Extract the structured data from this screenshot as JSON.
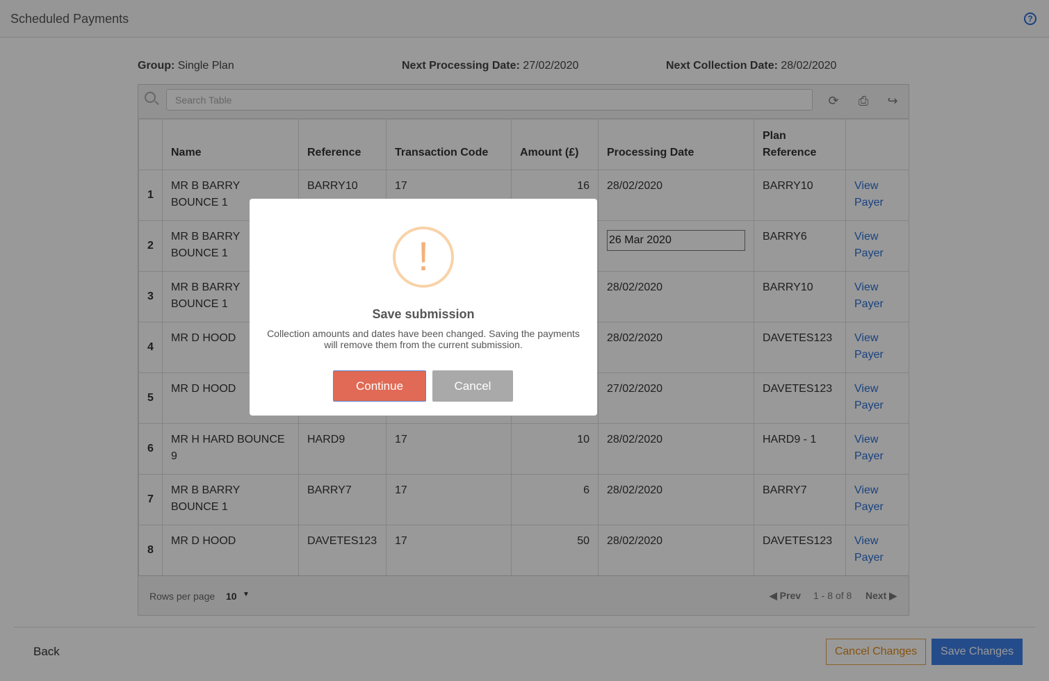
{
  "header": {
    "title": "Scheduled Payments",
    "help_icon": "?"
  },
  "info": {
    "group_label": "Group:",
    "group_value": "Single Plan",
    "processing_label": "Next Processing Date:",
    "processing_value": "27/02/2020",
    "collection_label": "Next Collection Date:",
    "collection_value": "28/02/2020"
  },
  "search": {
    "placeholder": "Search Table"
  },
  "toolbar": {
    "refresh_icon": "⟳",
    "print_icon": "⎙",
    "export_icon": "↪"
  },
  "table": {
    "headers": [
      "",
      "Name",
      "Reference",
      "Transaction Code",
      "Amount (£)",
      "Processing Date",
      "Plan Reference",
      ""
    ],
    "rows": [
      {
        "idx": "1",
        "name": "MR B BARRY BOUNCE 1",
        "reference": "BARRY10",
        "code": "17",
        "amount": "16",
        "date": "28/02/2020",
        "plan": "BARRY10",
        "link": "View Payer"
      },
      {
        "idx": "2",
        "name": "MR B BARRY BOUNCE 1",
        "reference": "",
        "code": "",
        "amount": "",
        "date": "26 Mar 2020",
        "plan": "BARRY6",
        "link": "View Payer"
      },
      {
        "idx": "3",
        "name": "MR B BARRY BOUNCE 1",
        "reference": "",
        "code": "",
        "amount": "",
        "date": "28/02/2020",
        "plan": "BARRY10",
        "link": "View Payer"
      },
      {
        "idx": "4",
        "name": "MR D HOOD",
        "reference": "",
        "code": "",
        "amount": "",
        "date": "28/02/2020",
        "plan": "DAVETES123",
        "link": "View Payer"
      },
      {
        "idx": "5",
        "name": "MR D HOOD",
        "reference": "",
        "code": "",
        "amount": "",
        "date": "27/02/2020",
        "plan": "DAVETES123",
        "link": "View Payer"
      },
      {
        "idx": "6",
        "name": "MR H HARD BOUNCE 9",
        "reference": "HARD9",
        "code": "17",
        "amount": "10",
        "date": "28/02/2020",
        "plan": "HARD9 - 1",
        "link": "View Payer"
      },
      {
        "idx": "7",
        "name": "MR B BARRY BOUNCE 1",
        "reference": "BARRY7",
        "code": "17",
        "amount": "6",
        "date": "28/02/2020",
        "plan": "BARRY7",
        "link": "View Payer"
      },
      {
        "idx": "8",
        "name": "MR D HOOD",
        "reference": "DAVETES123",
        "code": "17",
        "amount": "50",
        "date": "28/02/2020",
        "plan": "DAVETES123",
        "link": "View Payer"
      }
    ]
  },
  "pagination": {
    "rows_label": "Rows per page",
    "rows_value": "10",
    "prev": "Prev",
    "range": "1 - 8 of 8",
    "next": "Next"
  },
  "actions": {
    "back": "Back",
    "cancel_changes": "Cancel Changes",
    "save_changes": "Save Changes"
  },
  "modal": {
    "icon": "!",
    "title": "Save submission",
    "text": "Collection amounts and dates have been changed. Saving the payments will remove them from the current submission.",
    "continue": "Continue",
    "cancel": "Cancel"
  },
  "colors": {
    "accent": "#3f7fe6",
    "continue": "#e06a55",
    "warning": "#f4b07a",
    "cancel_changes": "#e08a1a"
  }
}
